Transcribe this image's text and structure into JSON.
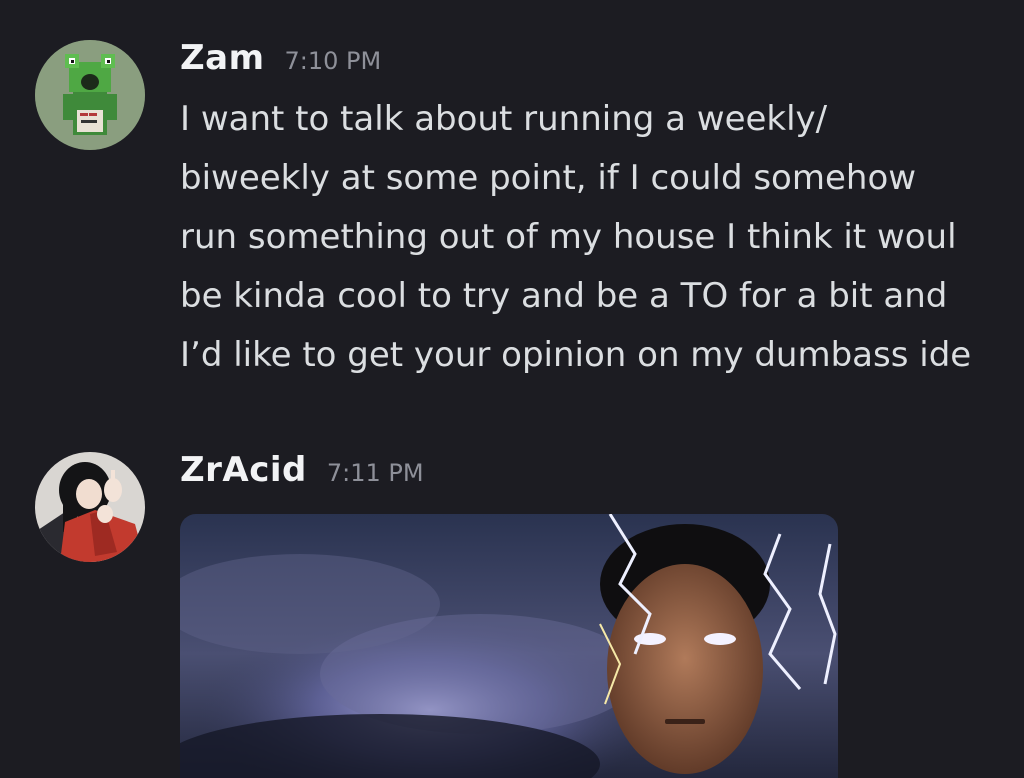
{
  "messages": [
    {
      "author": "Zam",
      "timestamp": "7:10 PM",
      "avatar_icon": "frog-avatar-icon",
      "lines": [
        "I want to talk about running a weekly/",
        "biweekly at some point, if I could somehow",
        "run something out of my house I think it woul",
        "be kinda cool to try and be a TO for a bit and",
        "I’d like to get your opinion on my dumbass ide"
      ]
    },
    {
      "author": "ZrAcid",
      "timestamp": "7:11 PM",
      "avatar_icon": "anime-character-avatar-icon",
      "attachment": {
        "type": "image",
        "icon": "lightning-storm-image"
      }
    }
  ],
  "colors": {
    "background": "#1c1c22",
    "author": "#f2f3f5",
    "timestamp": "#8e9099",
    "text": "#dbdee1"
  }
}
